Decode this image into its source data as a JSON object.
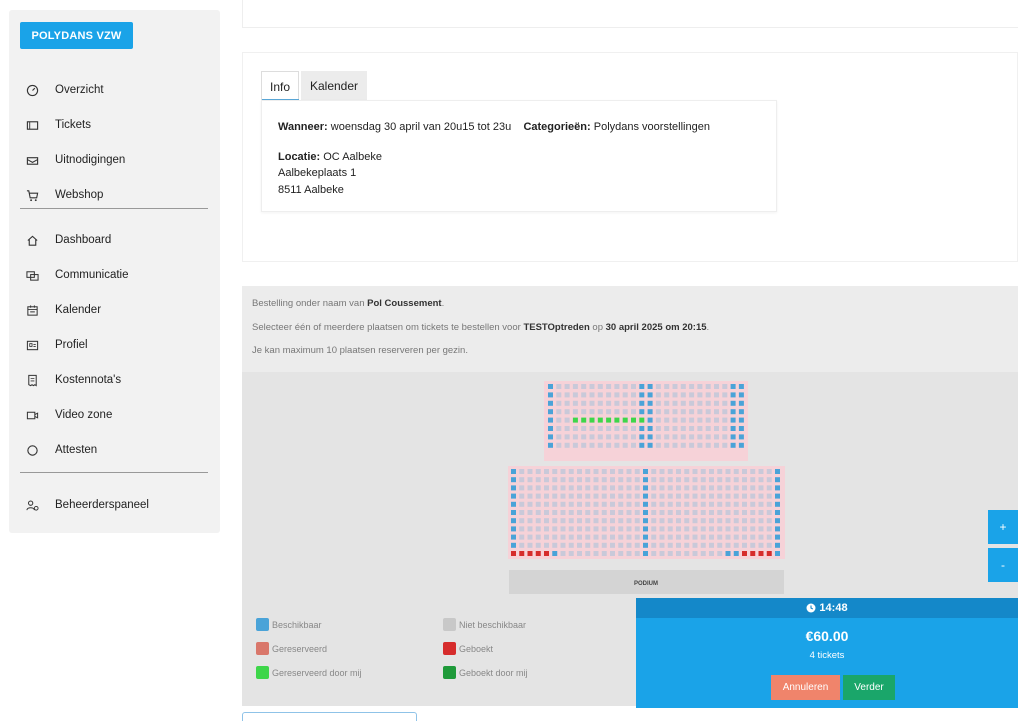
{
  "sidebar": {
    "org_button": "POLYDANS VZW",
    "items": [
      {
        "label": "Overzicht",
        "icon": "gauge-icon"
      },
      {
        "label": "Tickets",
        "icon": "ticket-icon"
      },
      {
        "label": "Uitnodigingen",
        "icon": "envelope-icon"
      },
      {
        "label": "Webshop",
        "icon": "cart-icon"
      },
      {
        "label": "Dashboard",
        "icon": "home-icon"
      },
      {
        "label": "Communicatie",
        "icon": "chat-icon"
      },
      {
        "label": "Kalender",
        "icon": "calendar-icon"
      },
      {
        "label": "Profiel",
        "icon": "id-card-icon"
      },
      {
        "label": "Kostennota's",
        "icon": "receipt-icon"
      },
      {
        "label": "Video zone",
        "icon": "video-icon"
      },
      {
        "label": "Attesten",
        "icon": "circle-icon"
      },
      {
        "label": "Beheerderspaneel",
        "icon": "admin-user-icon"
      }
    ]
  },
  "event": {
    "tabs": [
      "Info",
      "Kalender"
    ],
    "active_tab": "Info",
    "when_label": "Wanneer:",
    "when_value": "woensdag 30 april van 20u15 tot 23u",
    "category_label": "Categorieën:",
    "category_value": "Polydans voorstellingen",
    "location_label": "Locatie:",
    "location_name": "OC Aalbeke",
    "address_line1": "Aalbekeplaats 1",
    "address_line2": "8511 Aalbeke"
  },
  "order": {
    "line1_prefix": "Bestelling onder naam van ",
    "line1_name": "Pol Coussement",
    "line1_suffix": ".",
    "line2_prefix": "Selecteer één of meerdere plaatsen om tickets te bestellen voor ",
    "line2_show": "TESTOptreden",
    "line2_mid": " op ",
    "line2_date": "30 april 2025 om 20:15",
    "line2_suffix": ".",
    "line3": "Je kan maximum 10 plaatsen reserveren per gezin."
  },
  "stage_label": "PODIUM",
  "zoom": {
    "in": "+",
    "out": "-"
  },
  "legend": [
    {
      "label": "Beschikbaar",
      "color": "#4aa3d8"
    },
    {
      "label": "Niet beschikbaar",
      "color": "#c8c8c8"
    },
    {
      "label": "Gereserveerd",
      "color": "#d9776b"
    },
    {
      "label": "Geboekt",
      "color": "#d62c2c"
    },
    {
      "label": "Gereserveerd door mij",
      "color": "#3ed64a"
    },
    {
      "label": "Geboekt door mij",
      "color": "#1f9a3a"
    }
  ],
  "summary": {
    "timer": "14:48",
    "price": "€60.00",
    "tickets": "4 tickets",
    "cancel": "Annuleren",
    "next": "Verder"
  },
  "colors": {
    "accent": "#1aa3e8",
    "available": "#4aa3d8",
    "unavailable": "#c9c9d9",
    "mine": "#3ed64a",
    "booked": "#d62c2c"
  }
}
